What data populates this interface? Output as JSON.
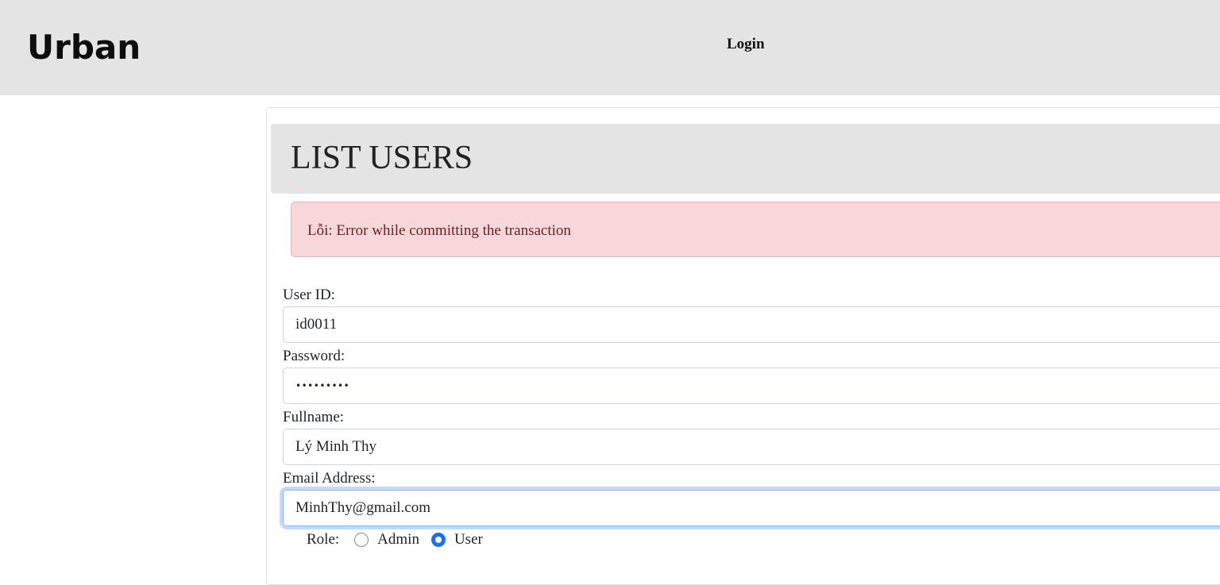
{
  "header": {
    "logo": "Urban",
    "nav_login": "Login"
  },
  "page": {
    "title": "LIST USERS"
  },
  "alert": {
    "message": "Lỗi: Error while committing the transaction",
    "color": "#f8d7da"
  },
  "form": {
    "user_id": {
      "label": "User ID:",
      "value": "id0011"
    },
    "password": {
      "label": "Password:",
      "masked_value": "•••••••••"
    },
    "fullname": {
      "label": "Fullname:",
      "value": "Lý Minh Thy"
    },
    "email": {
      "label": "Email Address:",
      "value": "MinhThy@gmail.com",
      "focused": true
    },
    "role": {
      "label": "Role:",
      "options": [
        {
          "label": "Admin",
          "checked": false
        },
        {
          "label": "User",
          "checked": true
        }
      ]
    }
  },
  "colors": {
    "topbar": "#e4e4e4",
    "accent": "#1a6ff5"
  }
}
